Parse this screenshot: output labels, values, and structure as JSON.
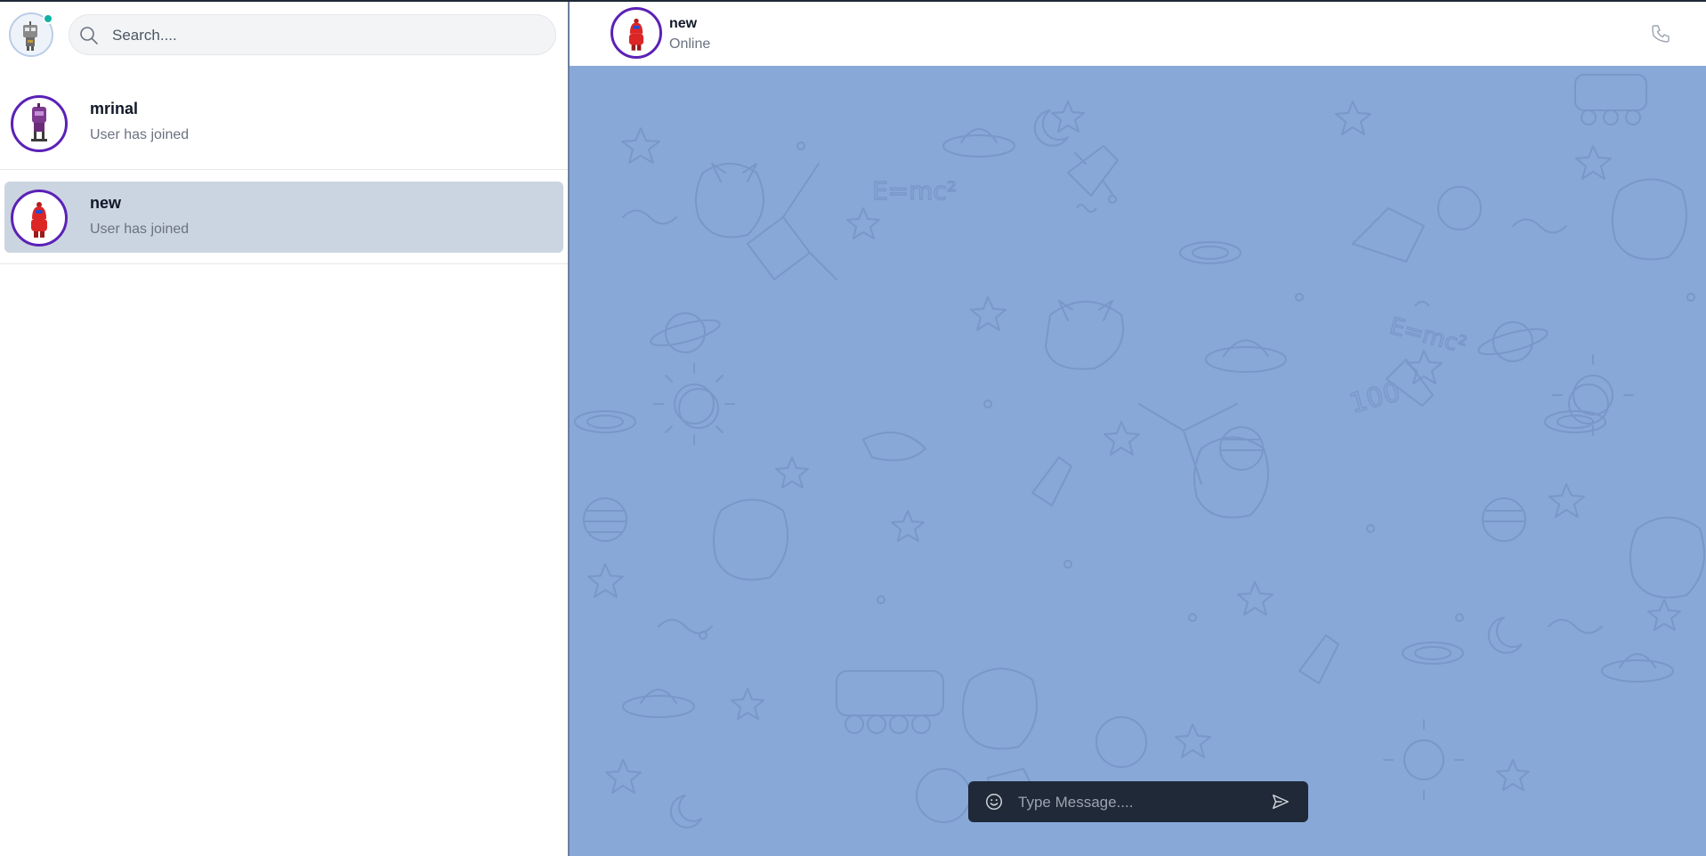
{
  "sidebar": {
    "search": {
      "placeholder": "Search...."
    },
    "current_user": {
      "avatar": "robot-avatar",
      "online": true,
      "status_color": "#10b3a3"
    },
    "chats": [
      {
        "name": "mrinal",
        "last_message": "User has joined",
        "avatar": "purple-robot-avatar",
        "active": false
      },
      {
        "name": "new",
        "last_message": "User has joined",
        "avatar": "red-robot-avatar",
        "active": true
      }
    ]
  },
  "chat": {
    "contact": {
      "name": "new",
      "status": "Online",
      "avatar": "red-robot-avatar"
    },
    "header_icons": [
      "phone-icon"
    ],
    "background": {
      "color": "#88a8d8",
      "pattern": "space-doodle-pattern"
    },
    "composer": {
      "placeholder": "Type Message....",
      "icons": [
        "emoji-icon",
        "send-icon"
      ]
    }
  },
  "colors": {
    "active_chat": "#cbd5e1",
    "avatar_ring": "#5b21b6",
    "composer_bg": "#1f2937"
  }
}
